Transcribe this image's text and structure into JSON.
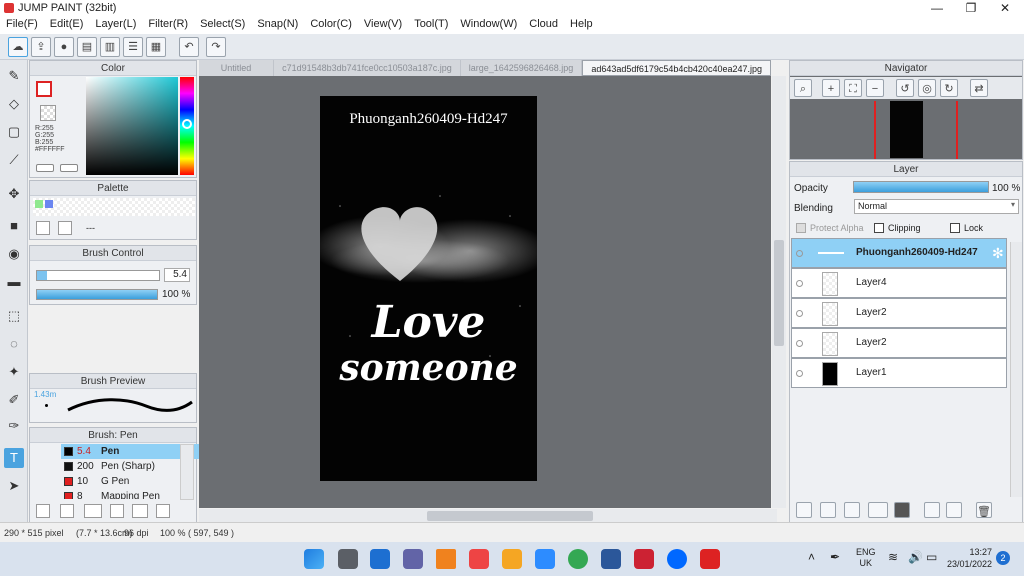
{
  "app": {
    "title": "JUMP PAINT (32bit)"
  },
  "window_controls": {
    "minimize": "—",
    "maximize": "❐",
    "close": "✕"
  },
  "menu": [
    "File(F)",
    "Edit(E)",
    "Layer(L)",
    "Filter(R)",
    "Select(S)",
    "Snap(N)",
    "Color(C)",
    "View(V)",
    "Tool(T)",
    "Window(W)",
    "Cloud",
    "Help"
  ],
  "tabs": [
    "Untitled",
    "c71d91548b3db741fce0cc10503a187c.jpg",
    "large_1642596826468.jpg",
    "ad643ad5df6179c54b4cb420c40ea247.jpg"
  ],
  "panels": {
    "color": {
      "title": "Color",
      "readout": [
        "R:255",
        "G:255",
        "B:255",
        "#FFFFFF"
      ]
    },
    "palette": {
      "title": "Palette",
      "footer": "---"
    },
    "brush_control": {
      "title": "Brush Control",
      "size_value": "5.4",
      "opacity_value": "100 %",
      "opacity_fraction": 1.0
    },
    "brush_preview": {
      "title": "Brush Preview",
      "size": "1.43m"
    },
    "brush": {
      "title": "Brush: Pen",
      "items": [
        {
          "size": "5.4",
          "name": "Pen",
          "swatch": "#000000",
          "selected": true
        },
        {
          "size": "200",
          "name": "Pen (Sharp)",
          "swatch": "#000000"
        },
        {
          "size": "10",
          "name": "G Pen",
          "swatch": "#e02020"
        },
        {
          "size": "8",
          "name": "Mapping Pen",
          "swatch": "#e02020"
        }
      ]
    },
    "navigator": {
      "title": "Navigator"
    },
    "layer": {
      "title": "Layer",
      "opacity_label": "Opacity",
      "opacity_value": "100 %",
      "opacity_fraction": 1.0,
      "blending_label": "Blending",
      "blending_value": "Normal",
      "protect_alpha": "Protect Alpha",
      "clipping": "Clipping",
      "lock": "Lock",
      "layers": [
        {
          "name": "Phuonganh260409-Hd247",
          "selected": true
        },
        {
          "name": "Layer4"
        },
        {
          "name": "Layer2"
        },
        {
          "name": "Layer2"
        },
        {
          "name": "Layer1"
        }
      ]
    }
  },
  "artwork": {
    "caption": "Phuonganh260409-Hd247",
    "line1": "Love",
    "line2": "someone"
  },
  "status": {
    "size": "290 * 515 pixel",
    "physical": "(7.7 * 13.6cm)",
    "dpi": "96 dpi",
    "zoom": "100 %",
    "cursor": "( 597, 549 )"
  },
  "taskbar": {
    "lang_top": "ENG",
    "lang_bottom": "UK",
    "time": "13:27",
    "date": "23/01/2022",
    "notif_count": "2"
  },
  "colors": {
    "accent": "#4aa3df",
    "selected_layer": "#8fd0f5",
    "canvas_bg": "#6b6e72"
  }
}
